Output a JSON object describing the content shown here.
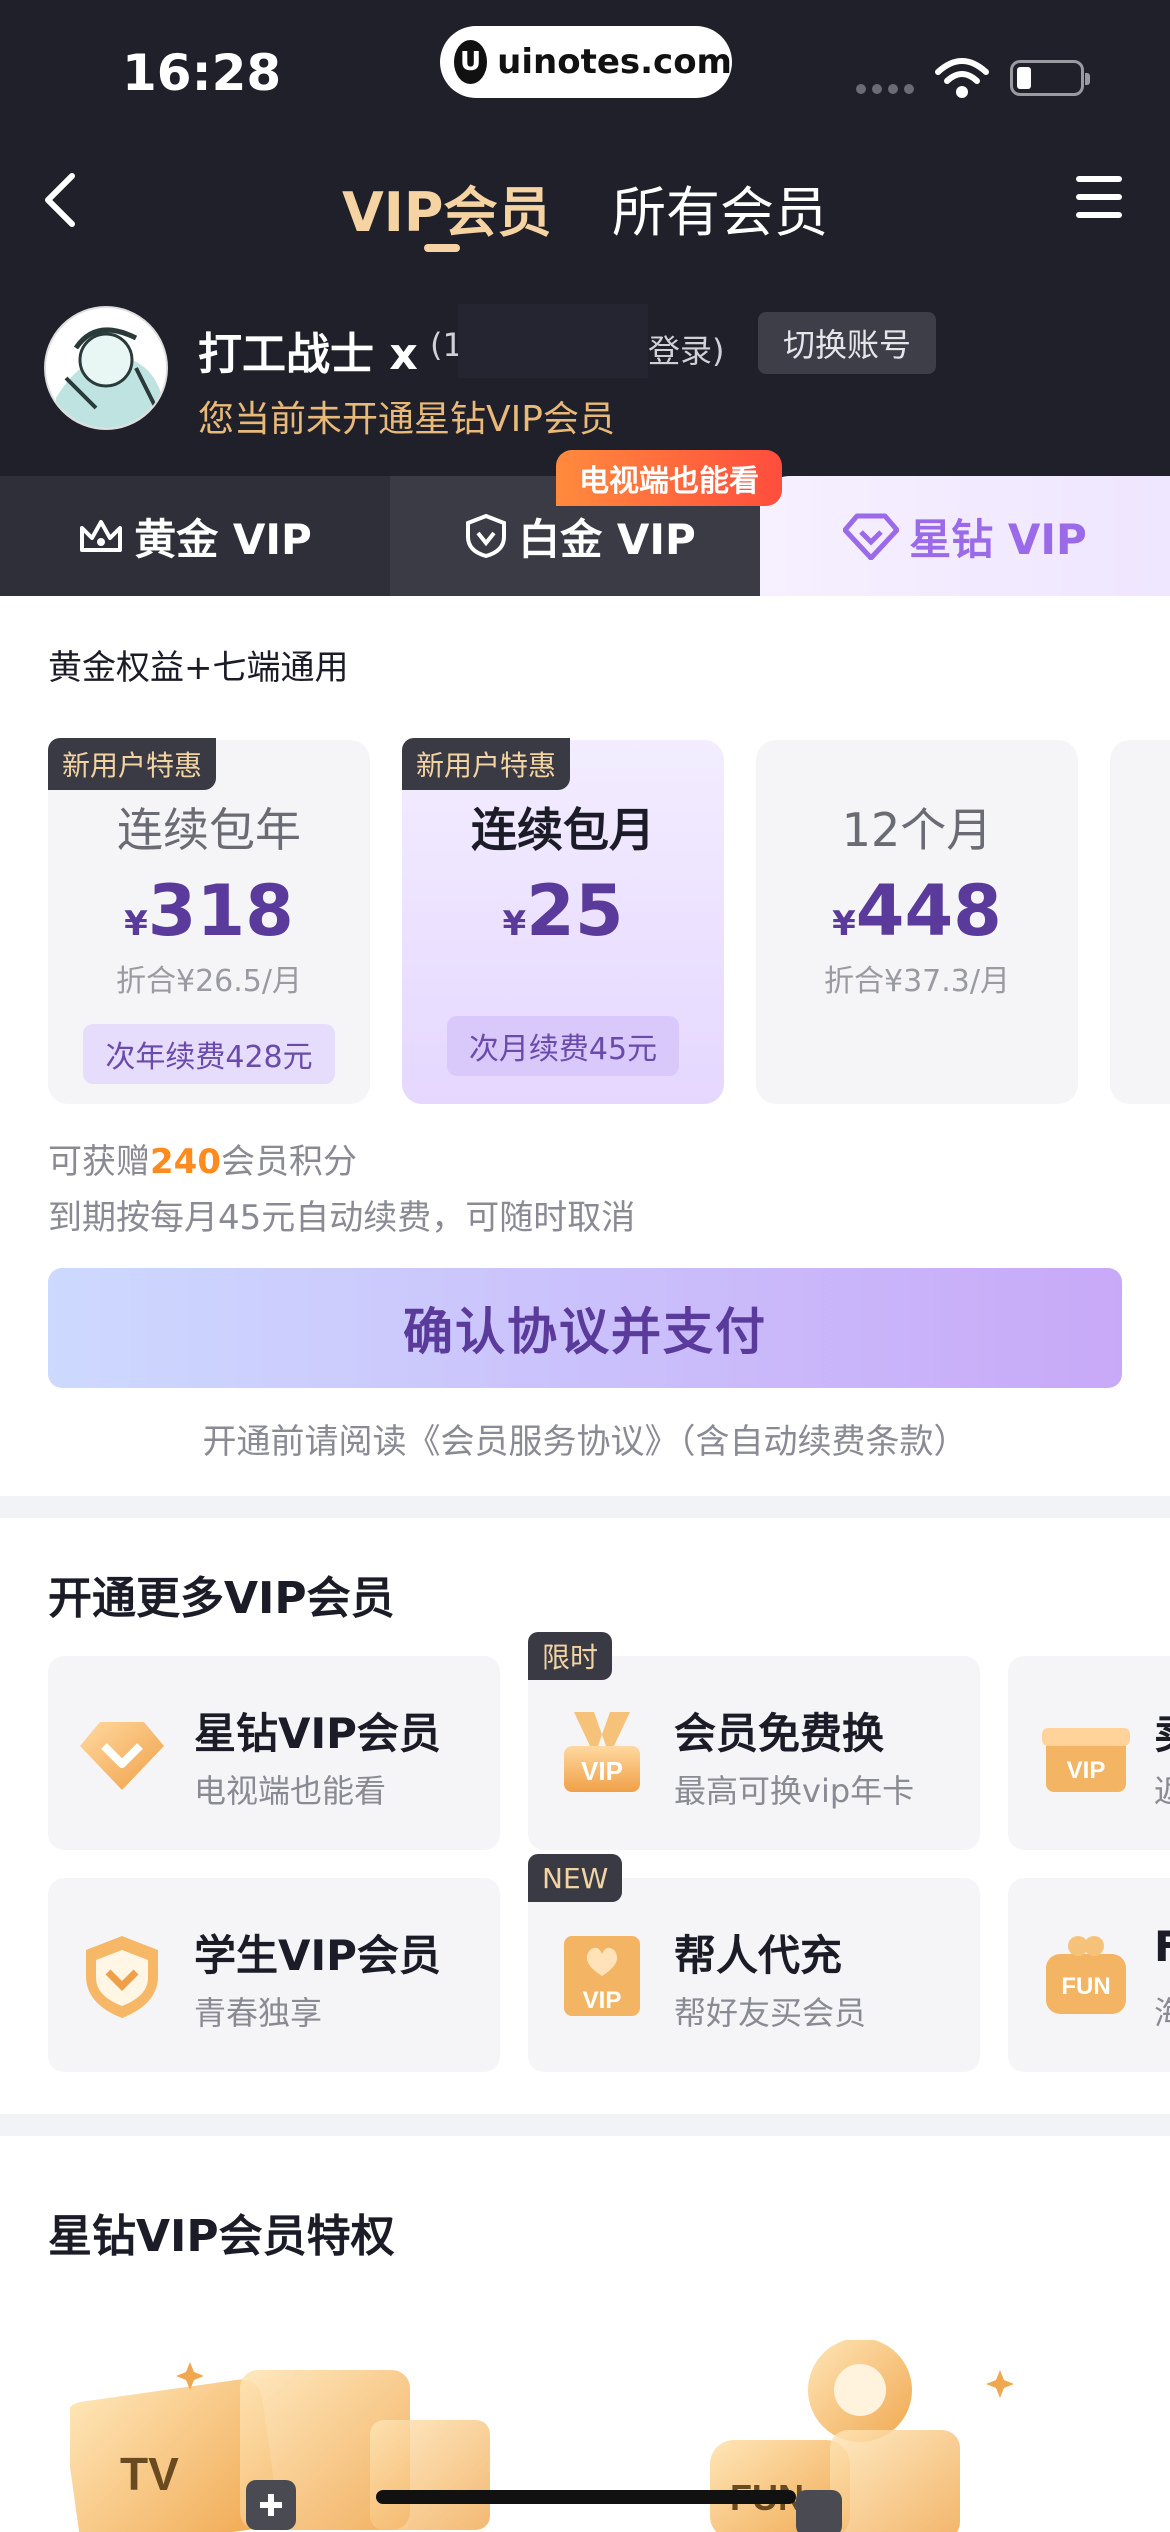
{
  "status_bar": {
    "time": "16:28",
    "site": "uinotes.com"
  },
  "nav": {
    "tab_vip": "VIP会员",
    "tab_all": "所有会员"
  },
  "user": {
    "name": "打工战士 x",
    "phone_prefix": "(1",
    "login_suffix": "登录)",
    "switch_label": "切换账号",
    "status": "您当前未开通星钻VIP会员"
  },
  "tiers": [
    {
      "label": "黄金 VIP",
      "icon": "crown-icon"
    },
    {
      "label": "白金 VIP",
      "icon": "shield-icon"
    },
    {
      "label": "星钻 VIP",
      "icon": "diamond-icon",
      "selected": true
    }
  ],
  "tier_badge": "电视端也能看",
  "plan_note": "黄金权益+七端通用",
  "plans": [
    {
      "tag": "新用户特惠",
      "name": "连续包年",
      "currency": "¥",
      "price": "318",
      "unit": "折合¥26.5/月",
      "renew": "次年续费428元"
    },
    {
      "tag": "新用户特惠",
      "name": "连续包月",
      "currency": "¥",
      "price": "25",
      "unit": "",
      "renew": "次月续费45元",
      "selected": true
    },
    {
      "tag": "",
      "name": "12个月",
      "currency": "¥",
      "price": "448",
      "unit": "折合¥37.3/月",
      "renew": ""
    }
  ],
  "points": {
    "prefix": "可获赠",
    "amount": "240",
    "suffix": "会员积分"
  },
  "renew_note": "到期按每月45元自动续费，可随时取消",
  "pay_button": "确认协议并支付",
  "agreement": "开通前请阅读《会员服务协议》（含自动续费条款）",
  "more_section": {
    "title": "开通更多VIP会员",
    "cards": [
      {
        "title": "星钻VIP会员",
        "subtitle": "电视端也能看",
        "icon": "diamond-icon",
        "tag": ""
      },
      {
        "title": "会员免费换",
        "subtitle": "最高可换vip年卡",
        "icon": "vip-medal-icon",
        "tag": "限时"
      },
      {
        "title": "卖",
        "subtitle": "返",
        "icon": "vip-gift-icon",
        "tag": ""
      },
      {
        "title": "学生VIP会员",
        "subtitle": "青春独享",
        "icon": "student-shield-icon",
        "tag": ""
      },
      {
        "title": "帮人代充",
        "subtitle": "帮好友买会员",
        "icon": "vip-heart-icon",
        "tag": "NEW"
      },
      {
        "title": "F",
        "subtitle": "海",
        "icon": "fun-gift-icon",
        "tag": ""
      }
    ]
  },
  "privilege_section": {
    "title": "星钻VIP会员特权"
  },
  "colors": {
    "header_bg": "#1f2029",
    "gold": "#f5d3a2",
    "accent_purple": "#5a3a9a",
    "points_orange": "#ff8a1e"
  }
}
